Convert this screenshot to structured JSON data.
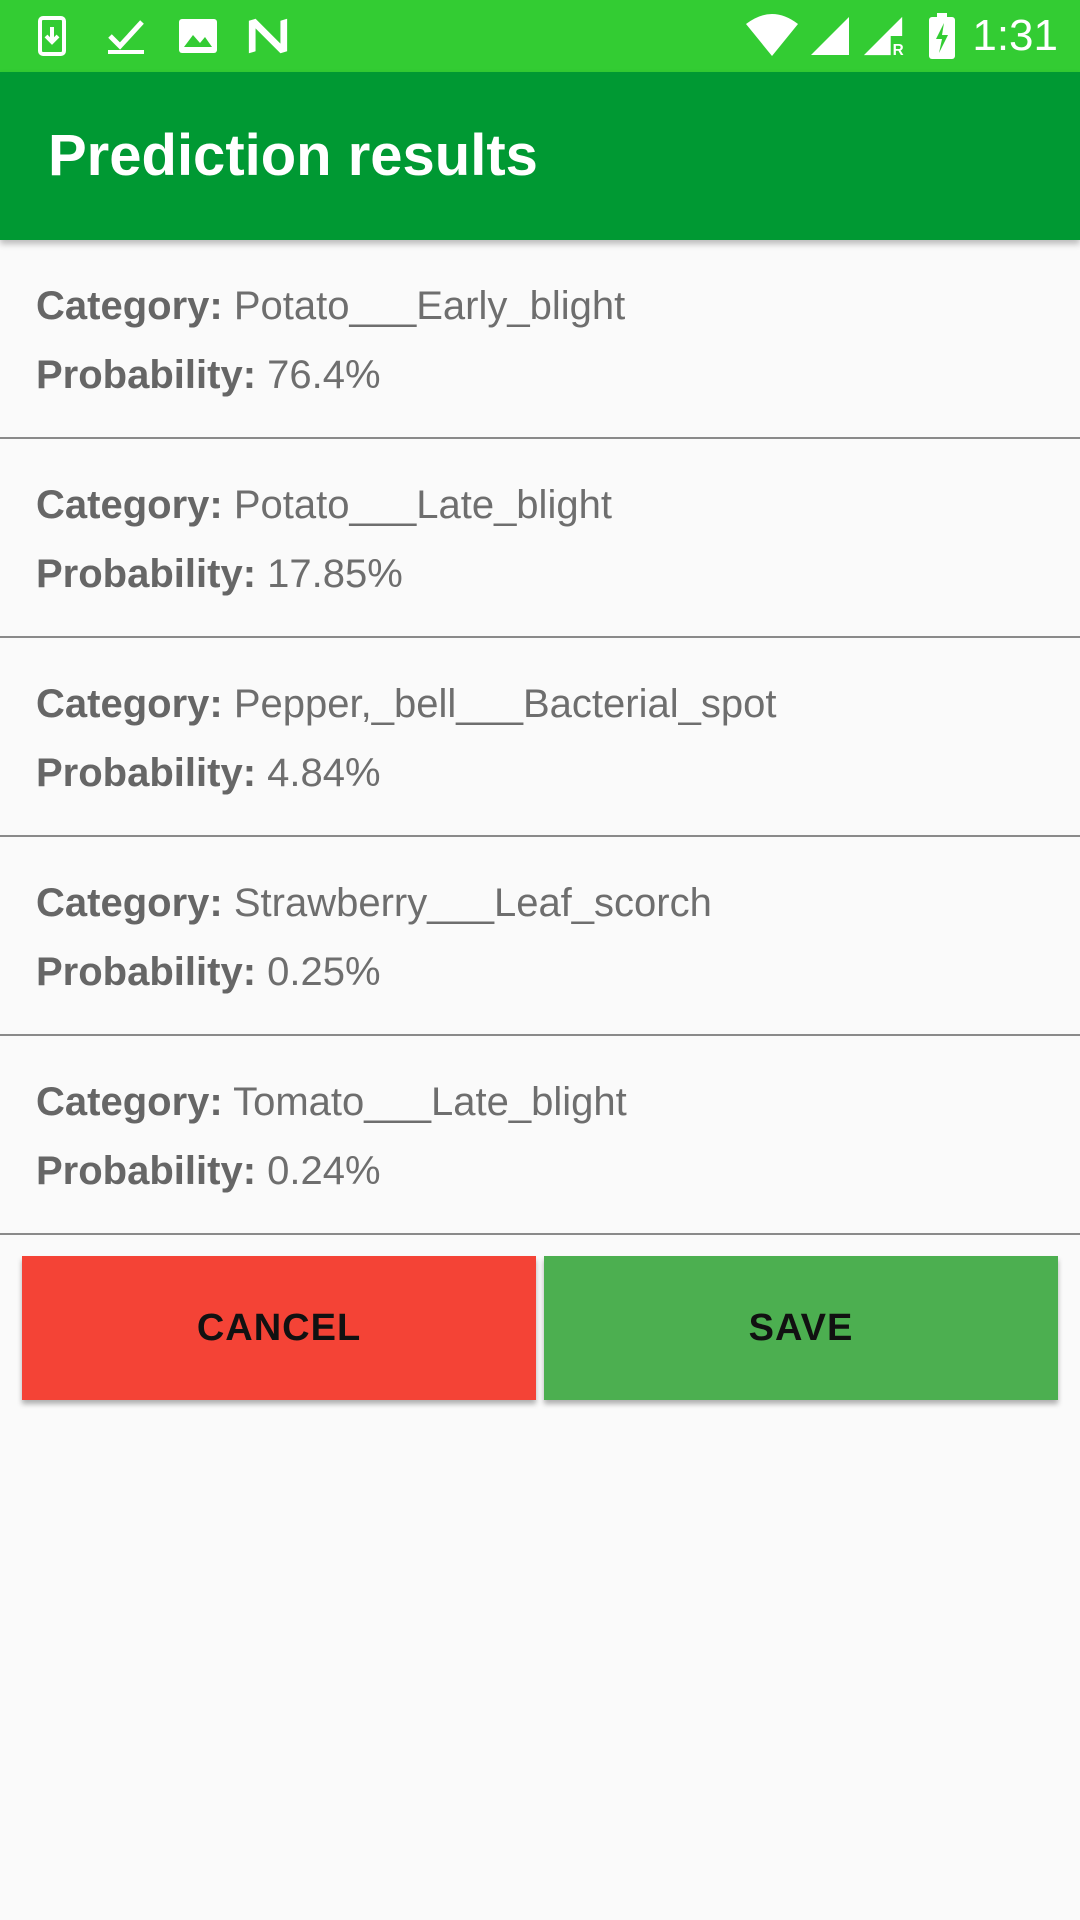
{
  "status_bar": {
    "time": "1:31",
    "bg_color": "#33cc33",
    "left_icons": [
      "download-icon",
      "checkmark-icon",
      "image-icon",
      "n-logo-icon"
    ],
    "right_icons": [
      "wifi-icon",
      "cell-signal-icon",
      "cell-signal-roaming-icon",
      "battery-charging-icon"
    ]
  },
  "app_bar": {
    "title": "Prediction results",
    "bg_color": "#009933"
  },
  "labels": {
    "category": "Category:",
    "probability": "Probability:"
  },
  "results": [
    {
      "category": "Potato___Early_blight",
      "probability": "76.4%"
    },
    {
      "category": "Potato___Late_blight",
      "probability": "17.85%"
    },
    {
      "category": "Pepper,_bell___Bacterial_spot",
      "probability": "4.84%"
    },
    {
      "category": "Strawberry___Leaf_scorch",
      "probability": "0.25%"
    },
    {
      "category": "Tomato___Late_blight",
      "probability": "0.24%"
    }
  ],
  "buttons": {
    "cancel_label": "CANCEL",
    "cancel_color": "#f44336",
    "save_label": "SAVE",
    "save_color": "#4caf50"
  }
}
